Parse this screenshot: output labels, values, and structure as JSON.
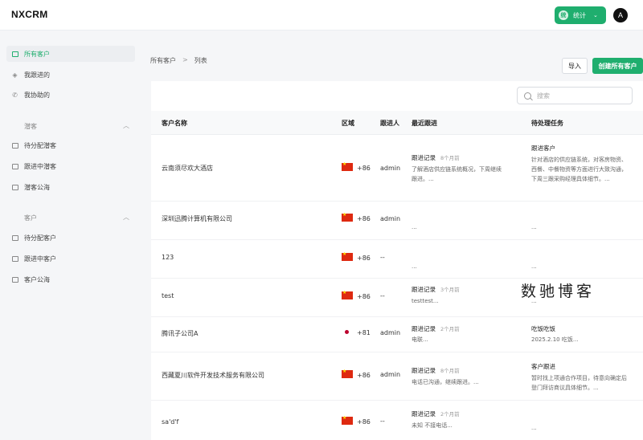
{
  "header": {
    "brand": "NXCRM",
    "stats_label": "统计",
    "stats_icon_text": "统",
    "avatar_letter": "A"
  },
  "sidebar": {
    "items": [
      {
        "label": "所有客户",
        "icon": "box-icon",
        "active": true
      },
      {
        "label": "我跟进的",
        "icon": "layers-icon"
      },
      {
        "label": "我协助的",
        "icon": "phone-icon"
      }
    ],
    "sections": [
      {
        "title": "潜客",
        "items": [
          {
            "label": "待分配潜客"
          },
          {
            "label": "跟进中潜客"
          },
          {
            "label": "潜客公海"
          }
        ]
      },
      {
        "title": "客户",
        "items": [
          {
            "label": "待分配客户"
          },
          {
            "label": "跟进中客户"
          },
          {
            "label": "客户公海"
          }
        ]
      }
    ]
  },
  "breadcrumb": {
    "root": "所有客户",
    "separator": ">",
    "current": "列表"
  },
  "actions": {
    "import_label": "导入",
    "create_label": "创建所有客户"
  },
  "search": {
    "placeholder": "搜索"
  },
  "table": {
    "headers": {
      "name": "客户名称",
      "region": "区域",
      "owner": "跟进人",
      "last_followup": "最近跟进",
      "pending_task": "待处理任务"
    },
    "rows": [
      {
        "name": "云南须尽欢大酒店",
        "flag": "cn",
        "code": "+86",
        "owner": "admin",
        "fu_title": "跟进记录",
        "fu_time": "8个月前",
        "fu_body": "了解酒店供应链系统概况，下周继续跟进。...",
        "task_title": "跟进客户",
        "task_body": "针对酒店的供应链系统，对客房物资、西餐、中餐物资等方面进行大致沟通，下周三跟采购经理具体细节。..."
      },
      {
        "name": "深圳迅腾计算机有限公司",
        "flag": "cn",
        "code": "+86",
        "owner": "admin",
        "fu_title": "",
        "fu_time": "",
        "fu_body": "...",
        "task_title": "",
        "task_body": "..."
      },
      {
        "name": "123",
        "flag": "cn",
        "code": "+86",
        "owner": "--",
        "fu_title": "",
        "fu_time": "",
        "fu_body": "...",
        "task_title": "",
        "task_body": "..."
      },
      {
        "name": "test",
        "flag": "cn",
        "code": "+86",
        "owner": "--",
        "fu_title": "跟进记录",
        "fu_time": "3个月前",
        "fu_body": "testtest...",
        "task_title": "",
        "task_body": "..."
      },
      {
        "name": "腾讯子公司A",
        "flag": "jp",
        "code": "+81",
        "owner": "admin",
        "fu_title": "跟进记录",
        "fu_time": "2个月前",
        "fu_body": "电联...",
        "task_title": "吃饭吃饭",
        "task_body": "2025.2.10 吃饭..."
      },
      {
        "name": "西藏夏川软件开发技术服务有限公司",
        "flag": "cn",
        "code": "+86",
        "owner": "admin",
        "fu_title": "跟进记录",
        "fu_time": "8个月前",
        "fu_body": "电话已沟通，继续跟进。...",
        "task_title": "客户跟进",
        "task_body": "暂时找上项通合作项目，待意向确定后登门拜访商议具体细节。..."
      },
      {
        "name": "sa'd'f",
        "flag": "cn",
        "code": "+86",
        "owner": "--",
        "fu_title": "跟进记录",
        "fu_time": "2个月前",
        "fu_body": "未知 不接电话...",
        "task_title": "",
        "task_body": "..."
      }
    ]
  },
  "watermark": "数驰博客",
  "colors": {
    "accent": "#1fae6e"
  }
}
